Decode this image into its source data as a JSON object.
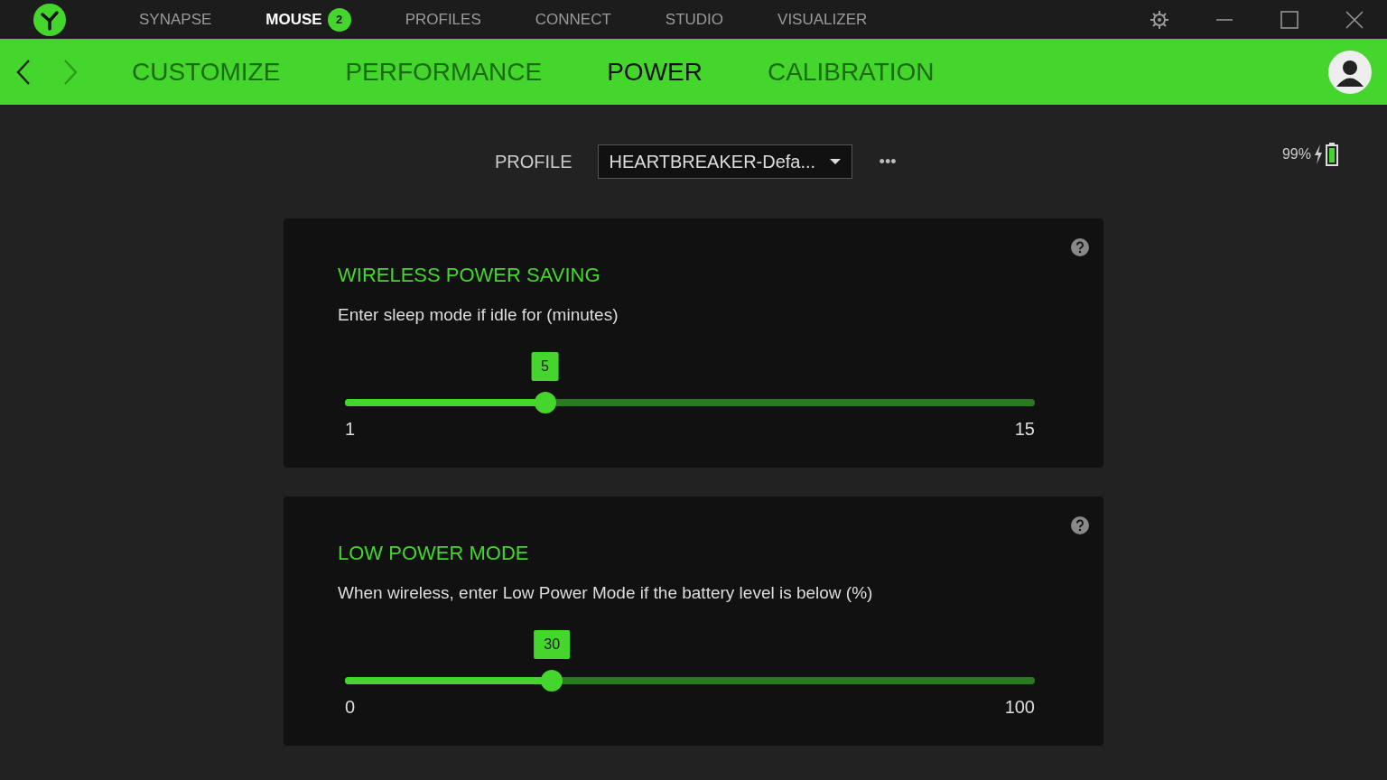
{
  "top_nav": [
    {
      "label": "SYNAPSE",
      "selected": false
    },
    {
      "label": "MOUSE",
      "selected": true,
      "badge": "2"
    },
    {
      "label": "PROFILES",
      "selected": false
    },
    {
      "label": "CONNECT",
      "selected": false
    },
    {
      "label": "STUDIO",
      "selected": false
    },
    {
      "label": "VISUALIZER",
      "selected": false
    }
  ],
  "sub_tabs": [
    {
      "label": "CUSTOMIZE",
      "selected": false
    },
    {
      "label": "PERFORMANCE",
      "selected": false
    },
    {
      "label": "POWER",
      "selected": true
    },
    {
      "label": "CALIBRATION",
      "selected": false
    }
  ],
  "profile": {
    "label": "PROFILE",
    "value": "HEARTBREAKER-Defa...",
    "more": "•••"
  },
  "battery": {
    "reading": "99%"
  },
  "cards": [
    {
      "title": "WIRELESS POWER SAVING",
      "description": "Enter sleep mode if idle for (minutes)",
      "value": "5",
      "level": 0.29,
      "min": "1",
      "max": "15"
    },
    {
      "title": "LOW POWER MODE",
      "description": "When wireless, enter Low Power Mode if the battery level is below (%)",
      "value": "30",
      "level": 0.3,
      "min": "0",
      "max": "100"
    }
  ]
}
